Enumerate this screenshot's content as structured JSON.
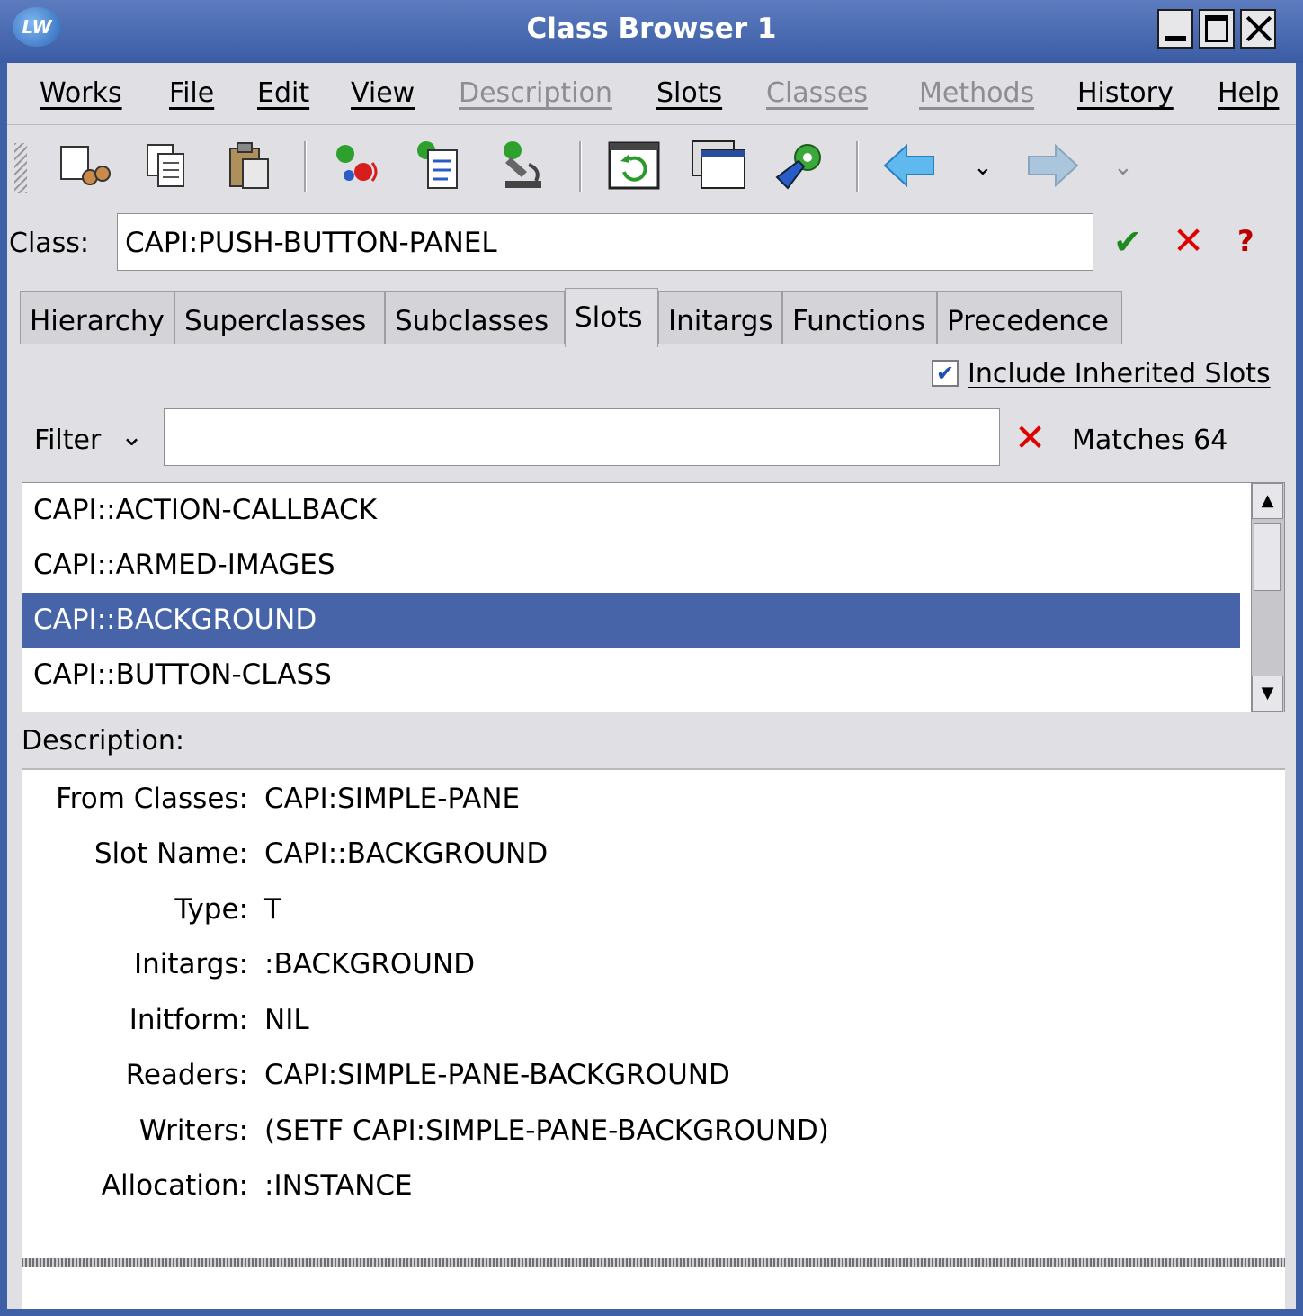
{
  "window": {
    "title": "Class Browser 1",
    "app_icon": "LW"
  },
  "menu": [
    {
      "label": "Works",
      "enabled": true
    },
    {
      "label": "File",
      "enabled": true
    },
    {
      "label": "Edit",
      "enabled": true
    },
    {
      "label": "View",
      "enabled": true
    },
    {
      "label": "Description",
      "enabled": false
    },
    {
      "label": "Slots",
      "enabled": true
    },
    {
      "label": "Classes",
      "enabled": false
    },
    {
      "label": "Methods",
      "enabled": false
    },
    {
      "label": "History",
      "enabled": true
    },
    {
      "label": "Help",
      "enabled": true
    }
  ],
  "toolbar": {
    "icons": [
      "cut-icon",
      "copy-icon",
      "paste-icon",
      "browse-object-icon",
      "browse-file-icon",
      "inspect-icon",
      "refresh-icon",
      "windows-icon",
      "tools-icon",
      "back-arrow-icon",
      "forward-arrow-icon"
    ]
  },
  "class_row": {
    "label": "Class:",
    "value": "CAPI:PUSH-BUTTON-PANEL"
  },
  "tabs": [
    "Hierarchy",
    "Superclasses",
    "Subclasses",
    "Slots",
    "Initargs",
    "Functions",
    "Precedence"
  ],
  "active_tab": "Slots",
  "include_inherited": {
    "label": "Include Inherited Slots",
    "checked": true
  },
  "filter": {
    "button": "Filter",
    "value": "",
    "matches": "Matches 64"
  },
  "slots": [
    "CAPI::ACTION-CALLBACK",
    "CAPI::ARMED-IMAGES",
    "CAPI::BACKGROUND",
    "CAPI::BUTTON-CLASS"
  ],
  "selected_slot": "CAPI::BACKGROUND",
  "description": {
    "label": "Description:",
    "fields": [
      {
        "label": "From Classes:",
        "value": "CAPI:SIMPLE-PANE"
      },
      {
        "label": "Slot Name:",
        "value": "CAPI::BACKGROUND"
      },
      {
        "label": "Type:",
        "value": "T"
      },
      {
        "label": "Initargs:",
        "value": ":BACKGROUND"
      },
      {
        "label": "Initform:",
        "value": "NIL"
      },
      {
        "label": "Readers:",
        "value": "CAPI:SIMPLE-PANE-BACKGROUND"
      },
      {
        "label": "Writers:",
        "value": "(SETF CAPI:SIMPLE-PANE-BACKGROUND)"
      },
      {
        "label": "Allocation:",
        "value": ":INSTANCE"
      }
    ]
  },
  "colors": {
    "titlebar": "#3b5ca4",
    "selection": "#4764a8",
    "accept": "#1f8a1f",
    "cancel": "#e00000"
  }
}
